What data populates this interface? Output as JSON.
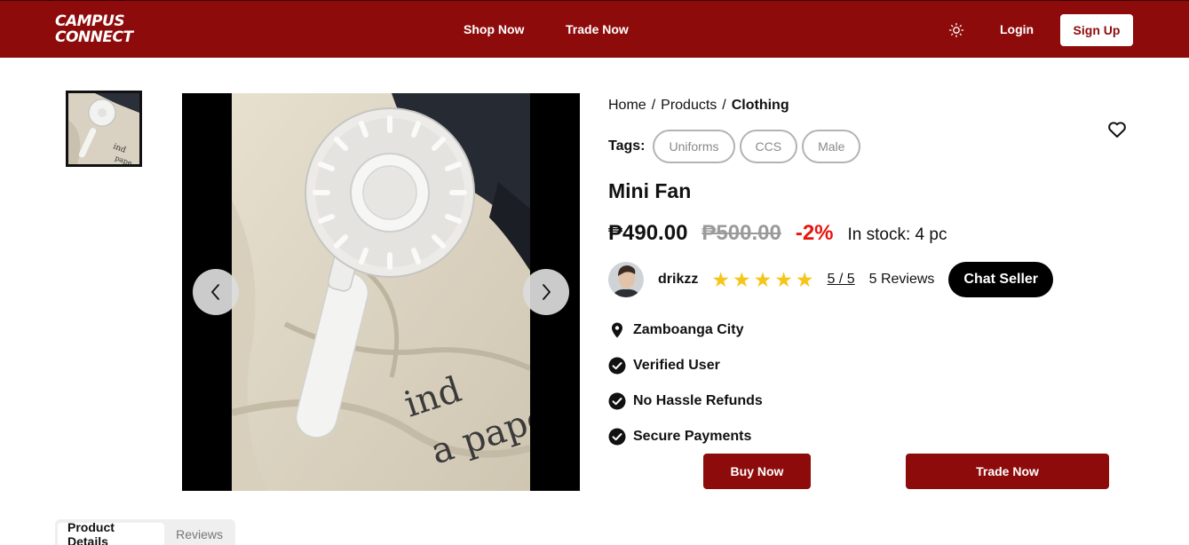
{
  "navbar": {
    "logo_line1": "CAMPUS",
    "logo_line2": "CONNECT",
    "shop_now": "Shop Now",
    "trade_now": "Trade Now",
    "login": "Login",
    "sign_up": "Sign Up",
    "theme_icon": "sun-icon",
    "brand_color": "#8e0b0b"
  },
  "breadcrumb": {
    "home": "Home",
    "products": "Products",
    "current": "Clothing",
    "separator": "/"
  },
  "tags": {
    "label": "Tags:",
    "items": [
      "Uniforms",
      "CCS",
      "Male"
    ]
  },
  "product": {
    "title": "Mini Fan",
    "price": "₱490.00",
    "old_price": "₱500.00",
    "discount": "-2%",
    "stock": "In stock: 4 pc"
  },
  "seller": {
    "name": "drikzz",
    "rating": "5 / 5",
    "star_count": 5,
    "reviews": "5 Reviews",
    "chat_label": "Chat Seller"
  },
  "features": {
    "location": "Zamboanga City",
    "verified": "Verified User",
    "refunds": "No Hassle Refunds",
    "payments": "Secure Payments"
  },
  "actions": {
    "buy_now": "Buy Now",
    "trade_now": "Trade Now"
  },
  "tabs": {
    "details": "Product Details",
    "reviews": "Reviews"
  },
  "colors": {
    "accent": "#8e0b0b",
    "discount": "#e8150e",
    "star": "#f5c518"
  }
}
